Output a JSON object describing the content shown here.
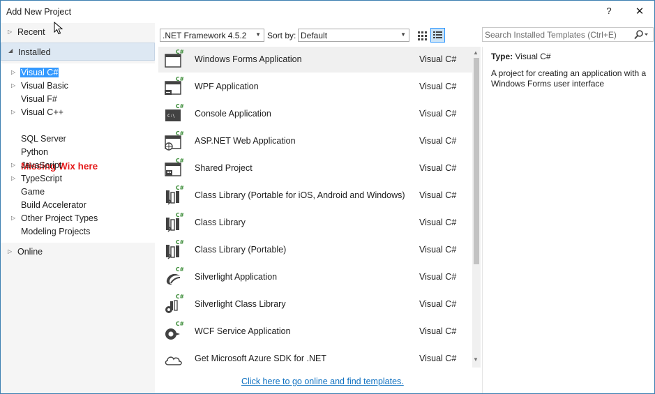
{
  "window": {
    "title": "Add New Project",
    "help": "?",
    "close": "✕"
  },
  "left": {
    "recent": "Recent",
    "installed": "Installed",
    "online": "Online",
    "tree": [
      {
        "label": "Visual C#",
        "expander": true,
        "selected": true
      },
      {
        "label": "Visual Basic",
        "expander": true
      },
      {
        "label": "Visual F#",
        "expander": false
      },
      {
        "label": "Visual C++",
        "expander": true
      },
      {
        "label": "SQL Server",
        "expander": false
      },
      {
        "label": "Python",
        "expander": false
      },
      {
        "label": "JavaScript",
        "expander": true
      },
      {
        "label": "TypeScript",
        "expander": true
      },
      {
        "label": "Game",
        "expander": false
      },
      {
        "label": "Build Accelerator",
        "expander": false
      },
      {
        "label": "Other Project Types",
        "expander": true
      },
      {
        "label": "Modeling Projects",
        "expander": false
      }
    ],
    "annotation": "Missing Wix here"
  },
  "toolbar": {
    "framework": ".NET Framework 4.5.2",
    "sort_label": "Sort by:",
    "sort_value": "Default"
  },
  "search": {
    "placeholder": "Search Installed Templates (Ctrl+E)"
  },
  "templates": [
    {
      "name": "Windows Forms Application",
      "lang": "Visual C#",
      "icon": "windows-forms-icon"
    },
    {
      "name": "WPF Application",
      "lang": "Visual C#",
      "icon": "wpf-icon"
    },
    {
      "name": "Console Application",
      "lang": "Visual C#",
      "icon": "console-icon"
    },
    {
      "name": "ASP.NET Web Application",
      "lang": "Visual C#",
      "icon": "web-icon"
    },
    {
      "name": "Shared Project",
      "lang": "Visual C#",
      "icon": "shared-project-icon"
    },
    {
      "name": "Class Library (Portable for iOS, Android and Windows)",
      "lang": "Visual C#",
      "icon": "class-library-icon"
    },
    {
      "name": "Class Library",
      "lang": "Visual C#",
      "icon": "class-library-icon"
    },
    {
      "name": "Class Library (Portable)",
      "lang": "Visual C#",
      "icon": "class-library-icon"
    },
    {
      "name": "Silverlight Application",
      "lang": "Visual C#",
      "icon": "silverlight-icon"
    },
    {
      "name": "Silverlight Class Library",
      "lang": "Visual C#",
      "icon": "silverlight-library-icon"
    },
    {
      "name": "WCF Service Application",
      "lang": "Visual C#",
      "icon": "wcf-icon"
    },
    {
      "name": "Get Microsoft Azure SDK for .NET",
      "lang": "Visual C#",
      "icon": "cloud-icon"
    }
  ],
  "online_link": "Click here to go online and find templates.",
  "details": {
    "type_label": "Type:",
    "type_value": "Visual C#",
    "description": "A project for creating an application with a Windows Forms user interface"
  },
  "colors": {
    "accent": "#3399ff",
    "link": "#0e70c0",
    "annotation": "#e51c1c",
    "csharp": "#388a34"
  }
}
